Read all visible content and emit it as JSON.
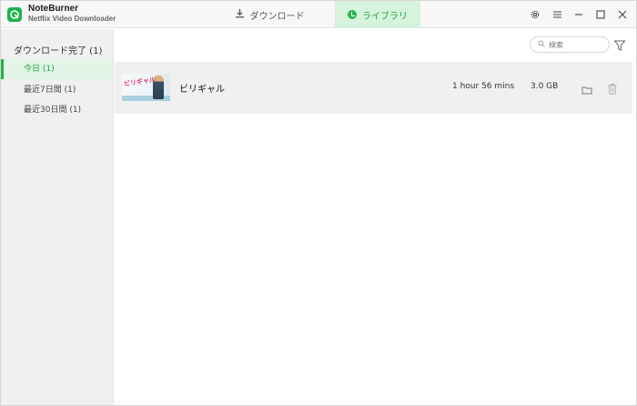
{
  "app": {
    "name": "NoteBurner",
    "subtitle": "Netflix Video Downloader"
  },
  "tabs": {
    "download": "ダウンロード",
    "library": "ライブラリ"
  },
  "sidebar": {
    "heading": "ダウンロード完了 (1)",
    "items": [
      {
        "label": "今日 (1)",
        "active": true
      },
      {
        "label": "最近7日間 (1)",
        "active": false
      },
      {
        "label": "最近30日間 (1)",
        "active": false
      }
    ]
  },
  "search": {
    "placeholder": "検索"
  },
  "items": [
    {
      "title": "ビリギャル",
      "thumbnail_text": "ビリギャル",
      "duration": "1 hour 56 mins",
      "size": "3.0 GB"
    }
  ],
  "colors": {
    "accent": "#22b14c",
    "accent_light": "#d6f3dc",
    "row_bg": "#f0f0f0"
  }
}
